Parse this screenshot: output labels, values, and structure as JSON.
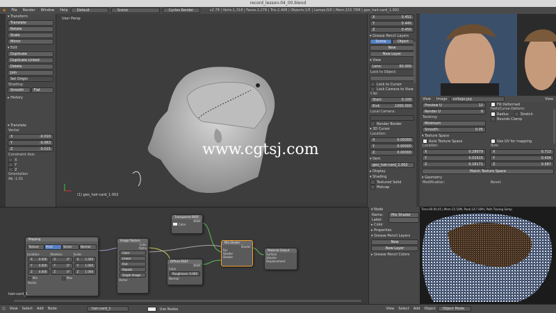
{
  "window": {
    "title": "record_lesson-04_00.blend"
  },
  "menu": {
    "items": [
      "File",
      "Render",
      "Window",
      "Help"
    ],
    "layout": "Default",
    "scene": "Scene",
    "engine": "Cycles Render",
    "stats": "v2.78 | Verts:1,318 | Faces:2,278 | Tris:2,408 | Objects:1/5 | Lamps:0/0 | Mem:215.76M | geo_hair-card_1.002"
  },
  "toolshelf": {
    "transform_header": "Transform",
    "transform_buttons": [
      "Translate",
      "Rotate",
      "Scale",
      "Mirror"
    ],
    "edit_header": "Edit",
    "edit_buttons": [
      "Duplicate",
      "Duplicate Linked",
      "Delete",
      "Join"
    ],
    "set_origin": "Set Origin",
    "shading_label": "Shading:",
    "smooth": "Smooth",
    "flat": "Flat",
    "history_header": "History",
    "translate_op_header": "Translate",
    "vector_label": "Vector",
    "vector": [
      {
        "axis": "X",
        "value": "-0.010"
      },
      {
        "axis": "Y",
        "value": "-0.063"
      },
      {
        "axis": "Z",
        "value": "-0.015"
      }
    ],
    "constraint_label": "Constraint Axis",
    "constraint_axes": [
      "X",
      "Y",
      "Z"
    ],
    "orientation_label": "Orientation",
    "orientation_value": "Ab -1.01"
  },
  "viewport": {
    "view_label": "User Persp",
    "object_label": "(1) geo_hair-card_1.002",
    "watermark": "www.cgtsj.com"
  },
  "props": {
    "dims": [
      {
        "axis": "X",
        "value": "0.452"
      },
      {
        "axis": "Y",
        "value": "0.440"
      },
      {
        "axis": "Z",
        "value": "0.450"
      }
    ],
    "gp_header": "Grease Pencil Layers",
    "gp_tabs": [
      "Scene",
      "Object"
    ],
    "new": "New",
    "new_layer": "New Layer",
    "view_header": "View",
    "lens": "Lens:",
    "lens_value": "60.000",
    "lock_object": "Lock to Object:",
    "lock_cursor": "Lock to Cursor",
    "lock_camera": "Lock Camera to View",
    "clip_label": "Clip:",
    "clip_start": "Start:",
    "clip_start_value": "0.100",
    "clip_end": "End:",
    "clip_end_value": "1000.000",
    "local_camera": "Local Camera:",
    "render_border": "Render Border",
    "cursor_header": "3D Cursor",
    "location": "Location:",
    "cursor": [
      {
        "axis": "X",
        "value": "0.00000"
      },
      {
        "axis": "Y",
        "value": "0.00000"
      },
      {
        "axis": "Z",
        "value": "0.00000"
      }
    ],
    "item_header": "Item",
    "item_name": "geo_hair-card_1.002",
    "display_header": "Display",
    "shading_header": "Shading",
    "textured_solid": "Textured Solid",
    "matcap": "Matcap"
  },
  "image_editor": {
    "menu": [
      "View",
      "Image"
    ],
    "image_name": "collage.jpg",
    "view": "View"
  },
  "texture": {
    "preview_u": "Preview U",
    "preview_u_value": "12",
    "render_u": "Render U",
    "render_u_value": "0",
    "fill_deformed": "Fill Deformed",
    "twisting": "Twisting:",
    "path_curve_deform": "Path/Curve-Deform:",
    "minimum": "Minimum",
    "radius": "Radius",
    "stretch": "Stretch",
    "smooth": "Smooth:",
    "smooth_value": "0.05",
    "bounds_clamp": "Bounds Clamp",
    "texspace_header": "Texture Space",
    "auto_texspace": "Auto Texture Space",
    "use_uv": "Use UV for mapping",
    "location": "Location:",
    "size": "Size:",
    "loc_values": [
      "0.28679",
      "0.01615",
      "0.18171"
    ],
    "size_values": [
      "0.713",
      "0.434",
      "0.587"
    ],
    "match": "Match Texture Space",
    "geometry_header": "Geometry",
    "modification": "Modification:",
    "bevel": "Bevel:"
  },
  "nodes": {
    "mapping": {
      "title": "Mapping",
      "tabs": [
        "Texture",
        "Point",
        "Vector",
        "Normal"
      ],
      "loc_label": "Location:",
      "rot_label": "Rotation:",
      "scale_label": "Scale:",
      "loc": [
        "0.000",
        "0.000",
        "0.000"
      ],
      "rot": [
        "0°",
        "0°",
        "0°"
      ],
      "scale": [
        "1.000",
        "1.000",
        "1.000"
      ],
      "min": "Min",
      "max": "Max",
      "vector": "Vector"
    },
    "image_texture": {
      "title": "Image Texture",
      "color": "Color",
      "alpha": "Alpha",
      "space": "Color",
      "interp": "Linear",
      "proj": "Flat",
      "ext": "Repeat",
      "source": "Single Image",
      "vector": "Vector"
    },
    "transparent": {
      "title": "Transparent BSDF",
      "bsdf": "BSDF",
      "color": "Color"
    },
    "diffuse": {
      "title": "Diffuse BSDF",
      "bsdf": "BSDF",
      "color": "Color",
      "roughness": "Roughness:",
      "roughness_value": "0.000",
      "normal": "Normal"
    },
    "mix": {
      "title": "Mix Shader",
      "shader": "Shader",
      "fac": "Fac",
      "in1": "Shader",
      "in2": "Shader"
    },
    "output": {
      "title": "Material Output",
      "surface": "Surface",
      "volume": "Volume",
      "displacement": "Displacement"
    },
    "frame_label": "hair-card_1"
  },
  "node_panel": {
    "node_header": "Node",
    "name": "Name:",
    "name_value": "Mix Shader",
    "label": "Label:",
    "color_header": "Color",
    "properties_header": "Properties",
    "gp_header": "Grease Pencil Layers",
    "new": "New",
    "new_layer": "New Layer",
    "gp_colors": "Grease Pencil Colors"
  },
  "render": {
    "stats": "Time:00:00.05 | Mem:15.50M, Peak:147.50M | Path Tracing Samp"
  },
  "bottombar": {
    "left": [
      "View",
      "Select",
      "Add",
      "Node"
    ],
    "material": "hair-card_1",
    "use_nodes": "Use Nodes",
    "right": [
      "View",
      "Select",
      "Add",
      "Object"
    ],
    "mode": "Object Mode"
  }
}
